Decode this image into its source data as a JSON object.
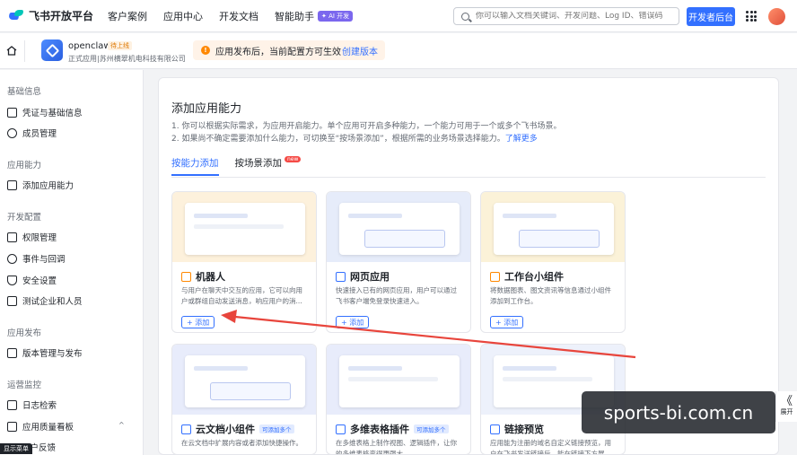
{
  "topbar": {
    "brand": "飞书开放平台",
    "nav": [
      "客户案例",
      "应用中心",
      "开发文档",
      "智能助手"
    ],
    "ai_badge": "✦ AI 开发",
    "search_placeholder": "你可以输入文档关键词、开发问题、Log ID、错误码",
    "dev_console": "开发者后台"
  },
  "app": {
    "name": "openclaw",
    "status": "待上线",
    "org": "正式应用|苏州横翠机电科技有限公司"
  },
  "notice": {
    "icon": "!",
    "message": "应用发布后，当前配置方可生效",
    "link": "创建版本"
  },
  "sidebar": {
    "sections": [
      {
        "title": "基础信息",
        "items": [
          "凭证与基础信息",
          "成员管理"
        ]
      },
      {
        "title": "应用能力",
        "items": [
          "添加应用能力"
        ]
      },
      {
        "title": "开发配置",
        "items": [
          "权限管理",
          "事件与回调",
          "安全设置",
          "测试企业和人员"
        ]
      },
      {
        "title": "应用发布",
        "items": [
          "版本管理与发布"
        ]
      },
      {
        "title": "运营监控",
        "items": [
          "日志检索",
          "应用质量看板",
          "用户反馈"
        ]
      }
    ],
    "chevron": "^",
    "tooltip": "显示菜单"
  },
  "main": {
    "title": "添加应用能力",
    "desc1": "1. 你可以根据实际需求，为应用开启能力。单个应用可开启多种能力，一个能力可用于一个或多个飞书场景。",
    "desc2": "2. 如果尚不确定需要添加什么能力，可切换至“按场景添加”，根据所需的业务场景选择能力。",
    "learn_more": "了解更多",
    "tabs": [
      {
        "label": "按能力添加",
        "active": true
      },
      {
        "label": "按场景添加",
        "badge": "new"
      }
    ],
    "cards": [
      {
        "title": "机器人",
        "desc": "与用户在聊天中交互的应用，它可以向用户或群组自动发送消息，响应用户的消...",
        "add": "+ 添加",
        "icon": "robot-icon"
      },
      {
        "title": "网页应用",
        "desc": "快速接入已有的网页应用，用户可以通过飞书客户端免登录快速进入。",
        "add": "+ 添加",
        "icon": "web-icon"
      },
      {
        "title": "工作台小组件",
        "desc": "将数据图表、图文资讯等信息通过小组件添加到工作台。",
        "add": "+ 添加",
        "icon": "widget-icon"
      },
      {
        "title": "云文档小组件",
        "desc": "在云文档中扩展内容或者添加快捷操作。",
        "tag": "可添加多个",
        "icon": "doc-icon"
      },
      {
        "title": "多维表格插件",
        "desc": "在多维表格上制作视图、逻辑插件，让你的多维表格变得更强大。",
        "tag": "可添加多个",
        "icon": "table-icon"
      },
      {
        "title": "链接预览",
        "desc": "应用能为注册的域名自定义链接预览，用户在飞书发送链接后，能在链接下方展...",
        "icon": "link-icon"
      }
    ]
  },
  "watermark": "sports-bi.com.cn",
  "collapse": {
    "chevron": "《",
    "label": "展开"
  }
}
